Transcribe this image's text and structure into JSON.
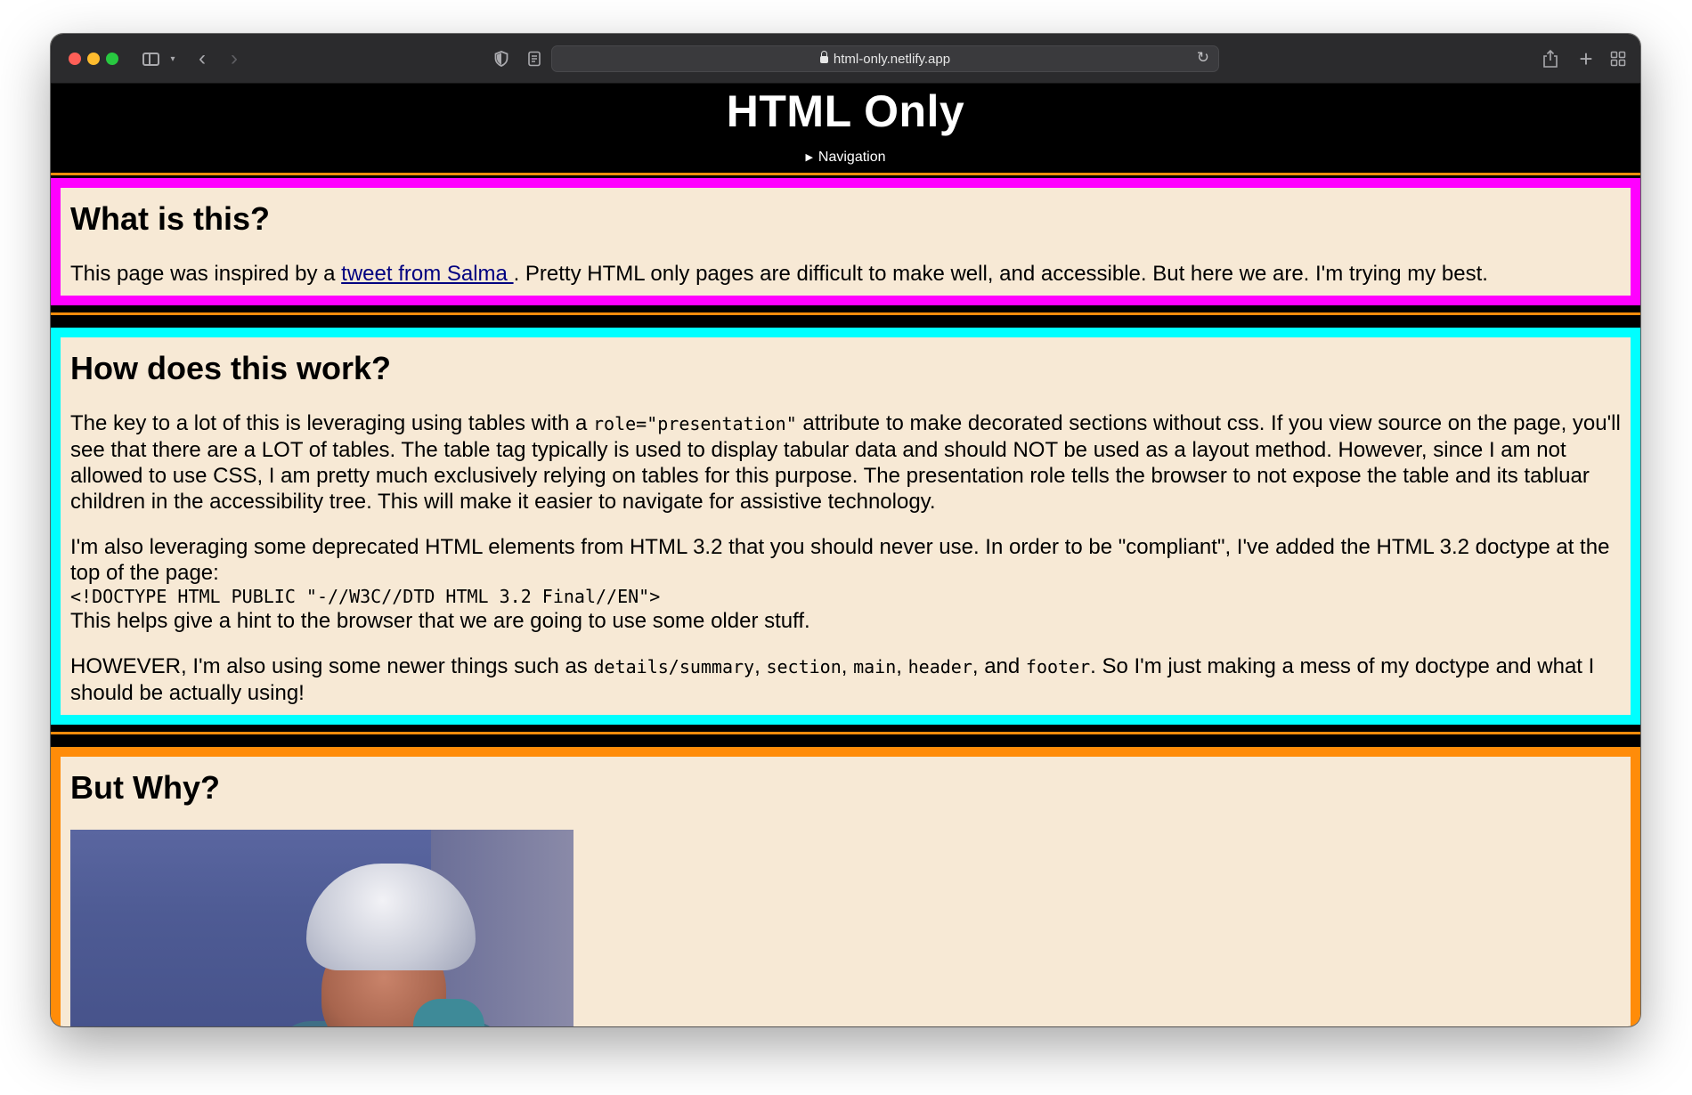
{
  "browser": {
    "url": "html-only.netlify.app",
    "traffic_lights": {
      "close": "#ff5f57",
      "minimize": "#febc2e",
      "zoom": "#28c840"
    },
    "icons": [
      "sidebar-icon",
      "chevron-down-icon",
      "back-icon",
      "forward-icon",
      "shield-icon",
      "reader-icon",
      "lock-icon",
      "reload-icon",
      "share-icon",
      "plus-icon",
      "tab-overview-icon"
    ]
  },
  "header": {
    "title": "HTML Only",
    "nav_label": "Navigation"
  },
  "sections": {
    "what": {
      "heading": "What is this?",
      "text_before": "This page was inspired by a ",
      "link_text": "tweet from Salma ",
      "text_after": ". Pretty HTML only pages are difficult to make well, and accessible. But here we are. I'm trying my best."
    },
    "how": {
      "heading": "How does this work?",
      "p1_a": "The key to a lot of this is leveraging using tables with a ",
      "p1_code": "role=\"presentation\"",
      "p1_b": " attribute to make decorated sections without css. If you view source on the page, you'll see that there are a LOT of tables. The table tag typically is used to display tabular data and should NOT be used as a layout method. However, since I am not allowed to use CSS, I am pretty much exclusively relying on tables for this purpose. The presentation role tells the browser to not expose the table and its tabluar children in the accessibility tree. This will make it easier to navigate for assistive technology.",
      "p2_a": "I'm also leveraging some deprecated HTML elements from HTML 3.2 that you should never use. In order to be \"compliant\", I've added the HTML 3.2 doctype at the top of the page:",
      "p2_code": "<!DOCTYPE HTML PUBLIC \"-//W3C//DTD HTML 3.2 Final//EN\">",
      "p2_b": "This helps give a hint to the browser that we are going to use some older stuff.",
      "p3_a": "HOWEVER, I'm also using some newer things such as ",
      "p3_code1": "details/summary",
      "p3_sep1": ", ",
      "p3_code2": "section",
      "p3_sep2": ", ",
      "p3_code3": "main",
      "p3_sep3": ", ",
      "p3_code4": "header",
      "p3_sep4": ", and ",
      "p3_code5": "footer",
      "p3_b": ". So I'm just making a mess of my doctype and what I should be actually using!"
    },
    "why": {
      "heading": "But Why?"
    }
  },
  "colors": {
    "section_bg": "#f7e9d5",
    "magenta": "#ff00ff",
    "cyan": "#00ffff",
    "orange": "#ff8c09",
    "link": "#000080"
  }
}
